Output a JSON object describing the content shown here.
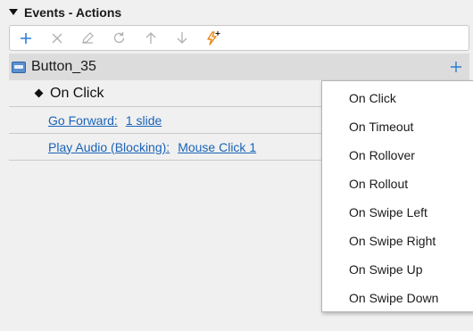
{
  "panel": {
    "title": "Events - Actions"
  },
  "toolbar": {
    "buttons": [
      {
        "icon": "plus-icon",
        "enabled": true,
        "color": "#2a7fd4"
      },
      {
        "icon": "close-icon",
        "enabled": false,
        "color": "#b0b0b0"
      },
      {
        "icon": "pencil-icon",
        "enabled": false,
        "color": "#b0b0b0"
      },
      {
        "icon": "refresh-icon",
        "enabled": false,
        "color": "#b0b0b0"
      },
      {
        "icon": "arrow-up-icon",
        "enabled": false,
        "color": "#b0b0b0"
      },
      {
        "icon": "arrow-down-icon",
        "enabled": false,
        "color": "#b0b0b0"
      },
      {
        "icon": "lightning-plus-icon",
        "enabled": true,
        "color": "#e88a1a"
      }
    ]
  },
  "object": {
    "name": "Button_35",
    "icon": "button-object-icon",
    "add_icon": "plus-icon"
  },
  "event": {
    "label": "On Click"
  },
  "actions": [
    {
      "name": "Go Forward:",
      "param": "1 slide"
    },
    {
      "name": "Play Audio (Blocking):",
      "param": "Mouse Click 1"
    }
  ],
  "dropdown": {
    "items": [
      "On Click",
      "On Timeout",
      "On Rollover",
      "On Rollout",
      "On Swipe Left",
      "On Swipe Right",
      "On Swipe Up",
      "On Swipe Down"
    ]
  },
  "colors": {
    "accent": "#2a7fd4",
    "link": "#1a63b8",
    "disabled": "#b0b0b0",
    "lightning": "#e88a1a"
  }
}
